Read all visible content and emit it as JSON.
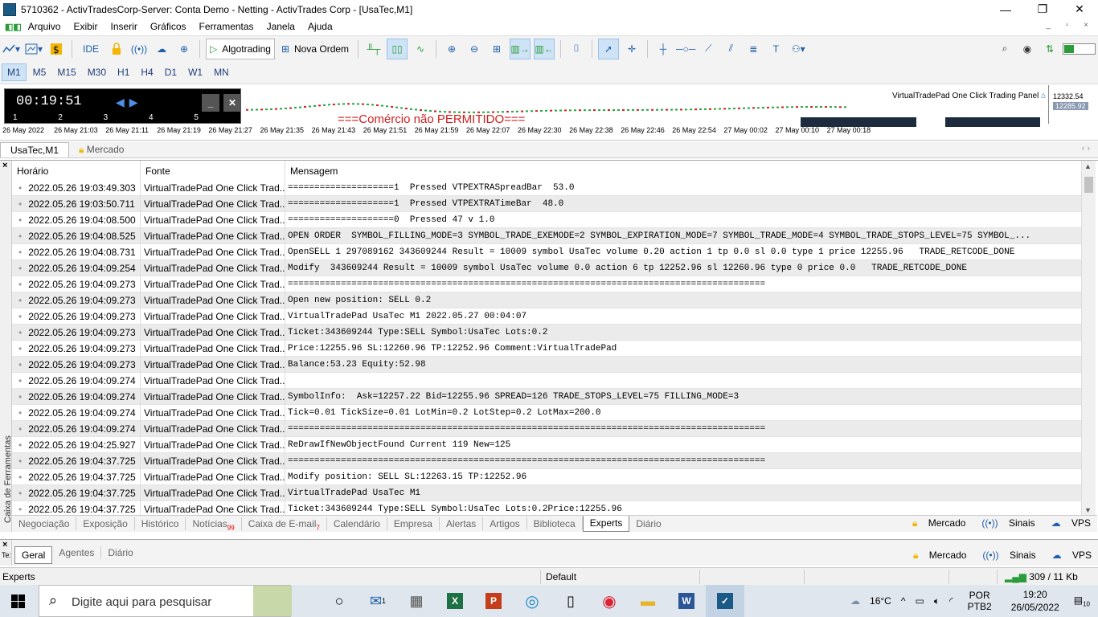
{
  "window": {
    "title": "5710362 - ActivTradesCorp-Server: Conta Demo - Netting - ActivTrades Corp - [UsaTec,M1]",
    "min": "—",
    "max": "❐",
    "close": "✕"
  },
  "menu": {
    "items": [
      "Arquivo",
      "Exibir",
      "Inserir",
      "Gráficos",
      "Ferramentas",
      "Janela",
      "Ajuda"
    ],
    "right_controls": "_ ▫ ×"
  },
  "toolbar": {
    "ide_label": "IDE",
    "algotrading_label": "Algotrading",
    "nova_ordem_label": "Nova Ordem"
  },
  "timeframes": [
    "M1",
    "M5",
    "M15",
    "M30",
    "H1",
    "H4",
    "D1",
    "W1",
    "MN"
  ],
  "chart": {
    "timer": "00:19:51",
    "timer_scale": "1 2 3 4 5",
    "panel_title": "VirtualTradePad One Click Trading Panel",
    "price_top": "12332.54",
    "price_current": "12285.92",
    "warning": "===Comércio não PERMITIDO===",
    "time_axis": [
      "26 May 2022",
      "26 May 21:03",
      "26 May 21:11",
      "26 May 21:19",
      "26 May 21:27",
      "26 May 21:35",
      "26 May 21:43",
      "26 May 21:51",
      "26 May 21:59",
      "26 May 22:07",
      "26 May 22:30",
      "26 May 22:38",
      "26 May 22:46",
      "26 May 22:54",
      "27 May 00:02",
      "27 May 00:10",
      "27 May 00:18"
    ]
  },
  "chart_tabs": [
    "UsaTec,M1",
    "Mercado"
  ],
  "toolbox": {
    "side_label": "Caixa de Ferramentas",
    "close": "×",
    "columns": [
      "Horário",
      "Fonte",
      "Mensagem"
    ],
    "rows": [
      {
        "time": "2022.05.26 19:03:49.303",
        "source": "VirtualTradePad One Click Trad...",
        "msg": "====================1  Pressed VTPEXTRASpreadBar  53.0"
      },
      {
        "time": "2022.05.26 19:03:50.711",
        "source": "VirtualTradePad One Click Trad...",
        "msg": "====================1  Pressed VTPEXTRATimeBar  48.0"
      },
      {
        "time": "2022.05.26 19:04:08.500",
        "source": "VirtualTradePad One Click Trad...",
        "msg": "====================0  Pressed 47 v 1.0"
      },
      {
        "time": "2022.05.26 19:04:08.525",
        "source": "VirtualTradePad One Click Trad...",
        "msg": "OPEN ORDER  SYMBOL_FILLING_MODE=3 SYMBOL_TRADE_EXEMODE=2 SYMBOL_EXPIRATION_MODE=7 SYMBOL_TRADE_MODE=4 SYMBOL_TRADE_STOPS_LEVEL=75 SYMBOL_..."
      },
      {
        "time": "2022.05.26 19:04:08.731",
        "source": "VirtualTradePad One Click Trad...",
        "msg": "OpenSELL 1 297089162 343609244 Result = 10009 symbol UsaTec volume 0.20 action 1 tp 0.0 sl 0.0 type 1 price 12255.96   TRADE_RETCODE_DONE"
      },
      {
        "time": "2022.05.26 19:04:09.254",
        "source": "VirtualTradePad One Click Trad...",
        "msg": "Modify  343609244 Result = 10009 symbol UsaTec volume 0.0 action 6 tp 12252.96 sl 12260.96 type 0 price 0.0   TRADE_RETCODE_DONE"
      },
      {
        "time": "2022.05.26 19:04:09.273",
        "source": "VirtualTradePad One Click Trad...",
        "msg": "=========================================================================================="
      },
      {
        "time": "2022.05.26 19:04:09.273",
        "source": "VirtualTradePad One Click Trad...",
        "msg": "Open new position: SELL 0.2"
      },
      {
        "time": "2022.05.26 19:04:09.273",
        "source": "VirtualTradePad One Click Trad...",
        "msg": "VirtualTradePad UsaTec M1 2022.05.27 00:04:07"
      },
      {
        "time": "2022.05.26 19:04:09.273",
        "source": "VirtualTradePad One Click Trad...",
        "msg": "Ticket:343609244 Type:SELL Symbol:UsaTec Lots:0.2"
      },
      {
        "time": "2022.05.26 19:04:09.273",
        "source": "VirtualTradePad One Click Trad...",
        "msg": "Price:12255.96 SL:12260.96 TP:12252.96 Comment:VirtualTradePad"
      },
      {
        "time": "2022.05.26 19:04:09.273",
        "source": "VirtualTradePad One Click Trad...",
        "msg": "Balance:53.23 Equity:52.98"
      },
      {
        "time": "2022.05.26 19:04:09.274",
        "source": "VirtualTradePad One Click Trad...",
        "msg": ""
      },
      {
        "time": "2022.05.26 19:04:09.274",
        "source": "VirtualTradePad One Click Trad...",
        "msg": "SymbolInfo:  Ask=12257.22 Bid=12255.96 SPREAD=126 TRADE_STOPS_LEVEL=75 FILLING_MODE=3"
      },
      {
        "time": "2022.05.26 19:04:09.274",
        "source": "VirtualTradePad One Click Trad...",
        "msg": "Tick=0.01 TickSize=0.01 LotMin=0.2 LotStep=0.2 LotMax=200.0"
      },
      {
        "time": "2022.05.26 19:04:09.274",
        "source": "VirtualTradePad One Click Trad...",
        "msg": "=========================================================================================="
      },
      {
        "time": "2022.05.26 19:04:25.927",
        "source": "VirtualTradePad One Click Trad...",
        "msg": "ReDrawIfNewObjectFound Current 119 New=125"
      },
      {
        "time": "2022.05.26 19:04:37.725",
        "source": "VirtualTradePad One Click Trad...",
        "msg": "=========================================================================================="
      },
      {
        "time": "2022.05.26 19:04:37.725",
        "source": "VirtualTradePad One Click Trad...",
        "msg": "Modify position: SELL SL:12263.15 TP:12252.96"
      },
      {
        "time": "2022.05.26 19:04:37.725",
        "source": "VirtualTradePad One Click Trad...",
        "msg": "VirtualTradePad UsaTec M1"
      },
      {
        "time": "2022.05.26 19:04:37.725",
        "source": "VirtualTradePad One Click Trad...",
        "msg": "Ticket:343609244 Type:SELL Symbol:UsaTec Lots:0.2Price:12255.96"
      }
    ],
    "tabs": [
      {
        "label": "Negociação"
      },
      {
        "label": "Exposição"
      },
      {
        "label": "Histórico"
      },
      {
        "label": "Notícias",
        "badge": "99"
      },
      {
        "label": "Caixa de E-mail",
        "badge": "7"
      },
      {
        "label": "Calendário"
      },
      {
        "label": "Empresa"
      },
      {
        "label": "Alertas"
      },
      {
        "label": "Artigos"
      },
      {
        "label": "Biblioteca"
      },
      {
        "label": "Experts"
      },
      {
        "label": "Diário"
      }
    ],
    "right_links": [
      "Mercado",
      "Sinais",
      "VPS"
    ]
  },
  "panel2": {
    "side_label": "Te:",
    "tabs": [
      "Geral",
      "Agentes",
      "Diário"
    ],
    "right_links": [
      "Mercado",
      "Sinais",
      "VPS"
    ]
  },
  "status": {
    "left": "Experts",
    "middle": "Default",
    "right": "309 / 11 Kb"
  },
  "taskbar": {
    "search_placeholder": "Digite aqui para pesquisar",
    "mail_badge": "1",
    "weather": "16°C",
    "lang_top": "POR",
    "lang_bottom": "PTB2",
    "time": "19:20",
    "date": "26/05/2022",
    "notifications": "10"
  },
  "colors": {
    "accent": "#1f5fa8",
    "selected_bg": "#cfe3f7",
    "warning": "#d02020",
    "row_alt": "#ebebeb"
  }
}
